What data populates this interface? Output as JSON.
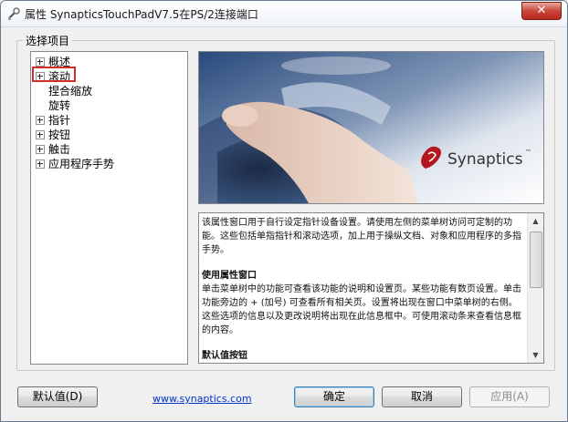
{
  "window": {
    "title": "属性 SynapticsTouchPadV7.5在PS/2连接端口",
    "close_label": "✕"
  },
  "group": {
    "label": "选择项目"
  },
  "tree": {
    "items": [
      {
        "label": "概述",
        "expandable": true
      },
      {
        "label": "滚动",
        "expandable": true,
        "highlighted": true
      },
      {
        "label": "捏合缩放",
        "expandable": false
      },
      {
        "label": "旋转",
        "expandable": false
      },
      {
        "label": "指针",
        "expandable": true
      },
      {
        "label": "按钮",
        "expandable": true
      },
      {
        "label": "触击",
        "expandable": true
      },
      {
        "label": "应用程序手势",
        "expandable": true
      }
    ]
  },
  "logo": {
    "text": "Synaptics",
    "tm": "™"
  },
  "description": {
    "intro": "该属性窗口用于自行设定指针设备设置。请使用左侧的菜单树访问可定制的功能。这些包括单指指针和滚动选项，加上用于操纵文档、对象和应用程序的多指手势。",
    "section_title": "使用属性窗口",
    "section_body": "单击菜单树中的功能可查看该功能的说明和设置页。某些功能有数页设置。单击功能旁边的 + (加号) 可查看所有相关页。设置将出现在窗口中菜单树的右侧。这些选项的信息以及更改说明将出现在此信息框中。可使用滚动条来查看信息框的内容。",
    "next_title": "默认值按钮"
  },
  "footer": {
    "defaults_label": "默认值(D)",
    "link_text": "www.synaptics.com",
    "ok_label": "确定",
    "cancel_label": "取消",
    "apply_label": "应用(A)"
  }
}
